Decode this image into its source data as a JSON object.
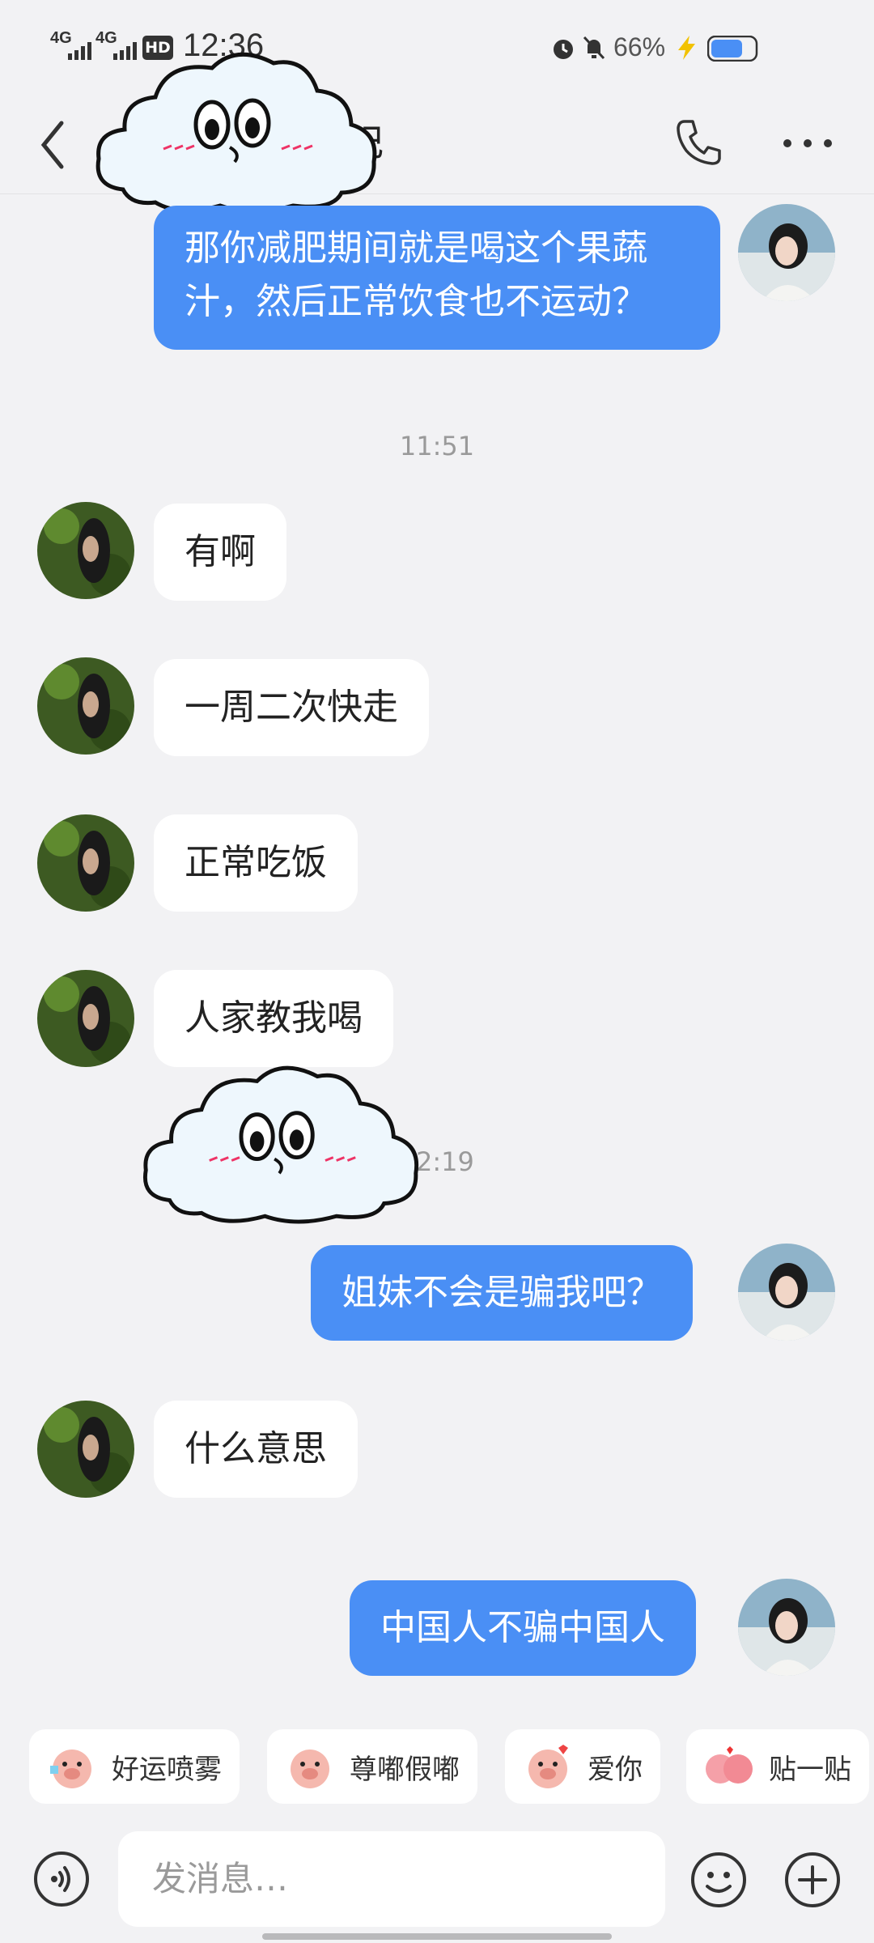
{
  "status_bar": {
    "time": "12:36",
    "battery": "66%",
    "net1": "4G",
    "net2": "4G",
    "hd": "HD"
  },
  "header": {
    "title_fragment": "妃"
  },
  "messages": [
    {
      "side": "out",
      "lines": [
        "那你减肥期间就是喝这个果蔬",
        "汁，然后正常饮食也不运动？"
      ]
    },
    {
      "type": "time",
      "text": "11:51"
    },
    {
      "side": "in",
      "text": "有啊"
    },
    {
      "side": "in",
      "text": "一周二次快走"
    },
    {
      "side": "in",
      "text": "正常吃饭"
    },
    {
      "side": "in",
      "text": "人家教我喝"
    },
    {
      "type": "time",
      "text": "2:19"
    },
    {
      "side": "out",
      "text": "姐妹不会是骗我吧？"
    },
    {
      "side": "in",
      "text": "什么意思"
    },
    {
      "side": "out",
      "text": "中国人不骗中国人"
    }
  ],
  "quick_stickers": [
    "好运喷雾",
    "尊嘟假嘟",
    "爱你",
    "贴一贴"
  ],
  "input": {
    "placeholder": "发消息…"
  },
  "colors": {
    "outgoing_bubble": "#4a8ff5",
    "incoming_bubble": "#ffffff",
    "background": "#f2f2f4"
  }
}
